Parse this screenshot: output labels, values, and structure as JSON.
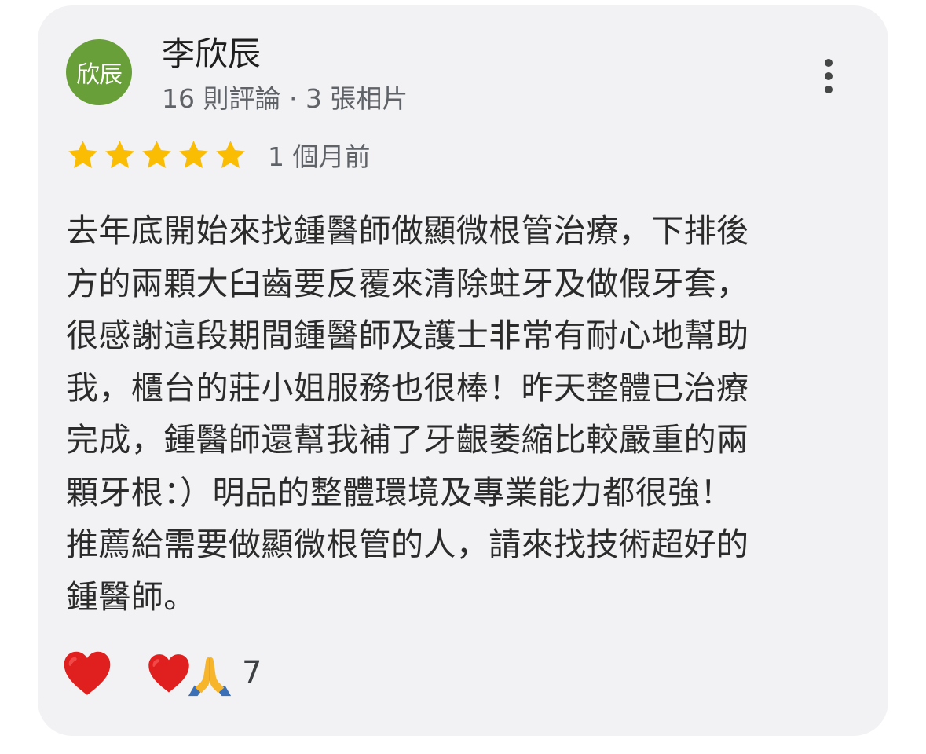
{
  "reviewer": {
    "avatar_text": "欣辰",
    "name": "李欣辰",
    "meta": "16 則評論 · 3 張相片"
  },
  "rating": {
    "stars": 5,
    "max_stars": 5,
    "time": "1 個月前"
  },
  "review": {
    "lines": [
      "去年底開始來找鍾醫師做顯微根管治療，下排後",
      "方的兩顆大臼齒要反覆來清除蛀牙及做假牙套，",
      "很感謝這段期間鍾醫師及護士非常有耐心地幫助",
      "我，櫃台的莊小姐服務也很棒！昨天整體已治療",
      "完成，鍾醫師還幫我補了牙齦萎縮比較嚴重的兩",
      "顆牙根：）明品的整體環境及專業能力都很強！",
      "推薦給需要做顯微根管的人，請來找技術超好的",
      "鍾醫師。"
    ]
  },
  "reactions": {
    "own_reaction_icon": "red-heart-icon",
    "summary_icons": [
      "red-heart-icon",
      "folded-hands-icon"
    ],
    "count": "7"
  },
  "colors": {
    "card_bg": "#f2f2f4",
    "avatar_bg": "#689f38",
    "star": "#fbbc04",
    "heart": "#e0201e"
  }
}
